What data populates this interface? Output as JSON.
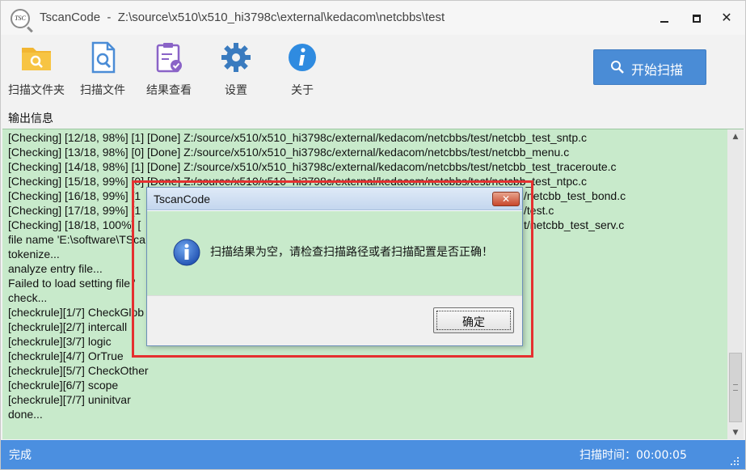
{
  "window": {
    "app_name": "TscanCode",
    "title_sep": "-",
    "path": "Z:\\source\\x510\\x510_hi3798c\\external\\kedacom\\netcbbs\\test",
    "app_icon_text": "TSC"
  },
  "toolbar": {
    "items": [
      {
        "label": "扫描文件夹",
        "icon": "folder-search-icon"
      },
      {
        "label": "扫描文件",
        "icon": "file-search-icon"
      },
      {
        "label": "结果查看",
        "icon": "result-clipboard-icon"
      },
      {
        "label": "设置",
        "icon": "gear-icon"
      },
      {
        "label": "关于",
        "icon": "info-icon"
      }
    ],
    "start_label": "开始扫描"
  },
  "output": {
    "label": "输出信息",
    "lines": [
      "[Checking] [12/18, 98%] [1] [Done] Z:/source/x510/x510_hi3798c/external/kedacom/netcbbs/test/netcbb_test_sntp.c",
      "[Checking] [13/18, 98%] [0] [Done] Z:/source/x510/x510_hi3798c/external/kedacom/netcbbs/test/netcbb_menu.c",
      "[Checking] [14/18, 98%] [1] [Done] Z:/source/x510/x510_hi3798c/external/kedacom/netcbbs/test/netcbb_test_traceroute.c",
      "[Checking] [15/18, 99%] [0] [Done] Z:/source/x510/x510_hi3798c/external/kedacom/netcbbs/test/netcbb_test_ntpc.c",
      "[Checking] [16/18, 99%] [1",
      "[Checking] [17/18, 99%] [1",
      "[Checking] [18/18, 100%] [",
      "file name 'E:\\software\\TSca",
      "tokenize...",
      "analyze entry file...",
      "Failed to load setting file '",
      "check...",
      "[checkrule][1/7] CheckGlob",
      "[checkrule][2/7] intercall",
      "[checkrule][3/7] logic",
      "[checkrule][4/7] OrTrue",
      "[checkrule][5/7] CheckOther",
      "[checkrule][6/7] scope",
      "[checkrule][7/7] uninitvar",
      "done..."
    ],
    "right_fragments": [
      "/netcbb_test_bond.c",
      "/test.c",
      "t/netcbb_test_serv.c"
    ]
  },
  "status": {
    "left": "完成",
    "right": "扫描时间：00:00:05"
  },
  "dialog": {
    "title": "TscanCode",
    "message": "扫描结果为空，请检查扫描路径或者扫描配置是否正确！",
    "ok_label": "确定",
    "close_glyph": "✕"
  },
  "colors": {
    "output_bg": "#c8eacb",
    "accent": "#4a8cd6",
    "status_bg": "#4b8fe0",
    "highlight": "#e53030"
  }
}
